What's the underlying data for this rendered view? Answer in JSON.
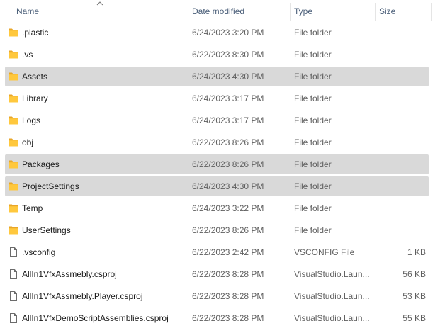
{
  "header": {
    "name": "Name",
    "date_modified": "Date modified",
    "type": "Type",
    "size": "Size"
  },
  "colors": {
    "folder_back": "#e8a628",
    "folder_front": "#ffc83d",
    "selected_row": "#d9d9d9",
    "header_text": "#4c607a"
  },
  "files": [
    {
      "icon": "folder-icon",
      "name": ".plastic",
      "date": "6/24/2023 3:20 PM",
      "type": "File folder",
      "size": "",
      "selected": false
    },
    {
      "icon": "folder-icon",
      "name": ".vs",
      "date": "6/22/2023 8:30 PM",
      "type": "File folder",
      "size": "",
      "selected": false
    },
    {
      "icon": "folder-icon",
      "name": "Assets",
      "date": "6/24/2023 4:30 PM",
      "type": "File folder",
      "size": "",
      "selected": true
    },
    {
      "icon": "folder-icon",
      "name": "Library",
      "date": "6/24/2023 3:17 PM",
      "type": "File folder",
      "size": "",
      "selected": false
    },
    {
      "icon": "folder-icon",
      "name": "Logs",
      "date": "6/24/2023 3:17 PM",
      "type": "File folder",
      "size": "",
      "selected": false
    },
    {
      "icon": "folder-icon",
      "name": "obj",
      "date": "6/22/2023 8:26 PM",
      "type": "File folder",
      "size": "",
      "selected": false
    },
    {
      "icon": "folder-icon",
      "name": "Packages",
      "date": "6/22/2023 8:26 PM",
      "type": "File folder",
      "size": "",
      "selected": true
    },
    {
      "icon": "folder-icon",
      "name": "ProjectSettings",
      "date": "6/24/2023 4:30 PM",
      "type": "File folder",
      "size": "",
      "selected": true
    },
    {
      "icon": "folder-icon",
      "name": "Temp",
      "date": "6/24/2023 3:22 PM",
      "type": "File folder",
      "size": "",
      "selected": false
    },
    {
      "icon": "folder-icon",
      "name": "UserSettings",
      "date": "6/22/2023 8:26 PM",
      "type": "File folder",
      "size": "",
      "selected": false
    },
    {
      "icon": "file-icon",
      "name": ".vsconfig",
      "date": "6/22/2023 2:42 PM",
      "type": "VSCONFIG File",
      "size": "1 KB",
      "selected": false
    },
    {
      "icon": "file-icon",
      "name": "AllIn1VfxAssmebly.csproj",
      "date": "6/22/2023 8:28 PM",
      "type": "VisualStudio.Laun...",
      "size": "56 KB",
      "selected": false
    },
    {
      "icon": "file-icon",
      "name": "AllIn1VfxAssmebly.Player.csproj",
      "date": "6/22/2023 8:28 PM",
      "type": "VisualStudio.Laun...",
      "size": "53 KB",
      "selected": false
    },
    {
      "icon": "file-icon",
      "name": "AllIn1VfxDemoScriptAssemblies.csproj",
      "date": "6/22/2023 8:28 PM",
      "type": "VisualStudio.Laun...",
      "size": "55 KB",
      "selected": false
    }
  ]
}
